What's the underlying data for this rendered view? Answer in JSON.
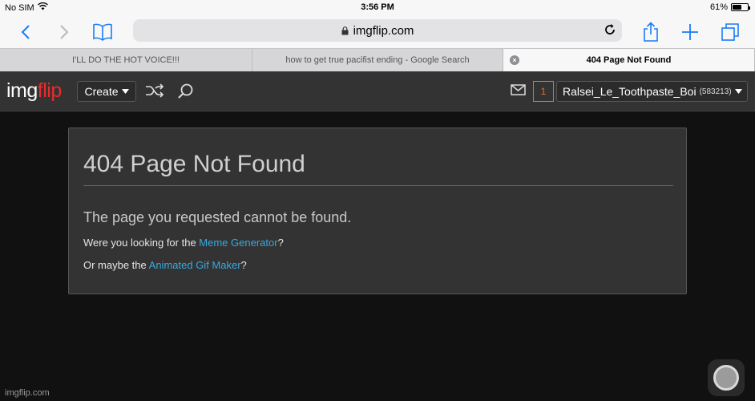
{
  "status_bar": {
    "carrier": "No SIM",
    "time": "3:56 PM",
    "battery": "61%",
    "battery_level": 0.61
  },
  "browser": {
    "address": "imgflip.com",
    "tabs": [
      {
        "title": "I'LL DO THE HOT VOICE!!!"
      },
      {
        "title": "how to get true pacifist ending - Google Search"
      },
      {
        "title": "404 Page Not Found",
        "active": true
      }
    ],
    "close_glyph": "×"
  },
  "site_header": {
    "logo_part1": "img",
    "logo_part2": "flip",
    "create_label": "Create",
    "notification_count": "1",
    "username": "Ralsei_Le_Toothpaste_Boi",
    "user_points": "(583213)",
    "logo_colors": {
      "img": "#ffffff",
      "flip": "#e52d2d"
    }
  },
  "content": {
    "title": "404 Page Not Found",
    "lead": "The page you requested cannot be found.",
    "line1_prefix": "Were you looking for the ",
    "line1_link": "Meme Generator",
    "line1_suffix": "?",
    "line2_prefix": "Or maybe the ",
    "line2_link": "Animated Gif Maker",
    "line2_suffix": "?",
    "link_color": "#38a9e0"
  },
  "watermark": "imgflip.com"
}
